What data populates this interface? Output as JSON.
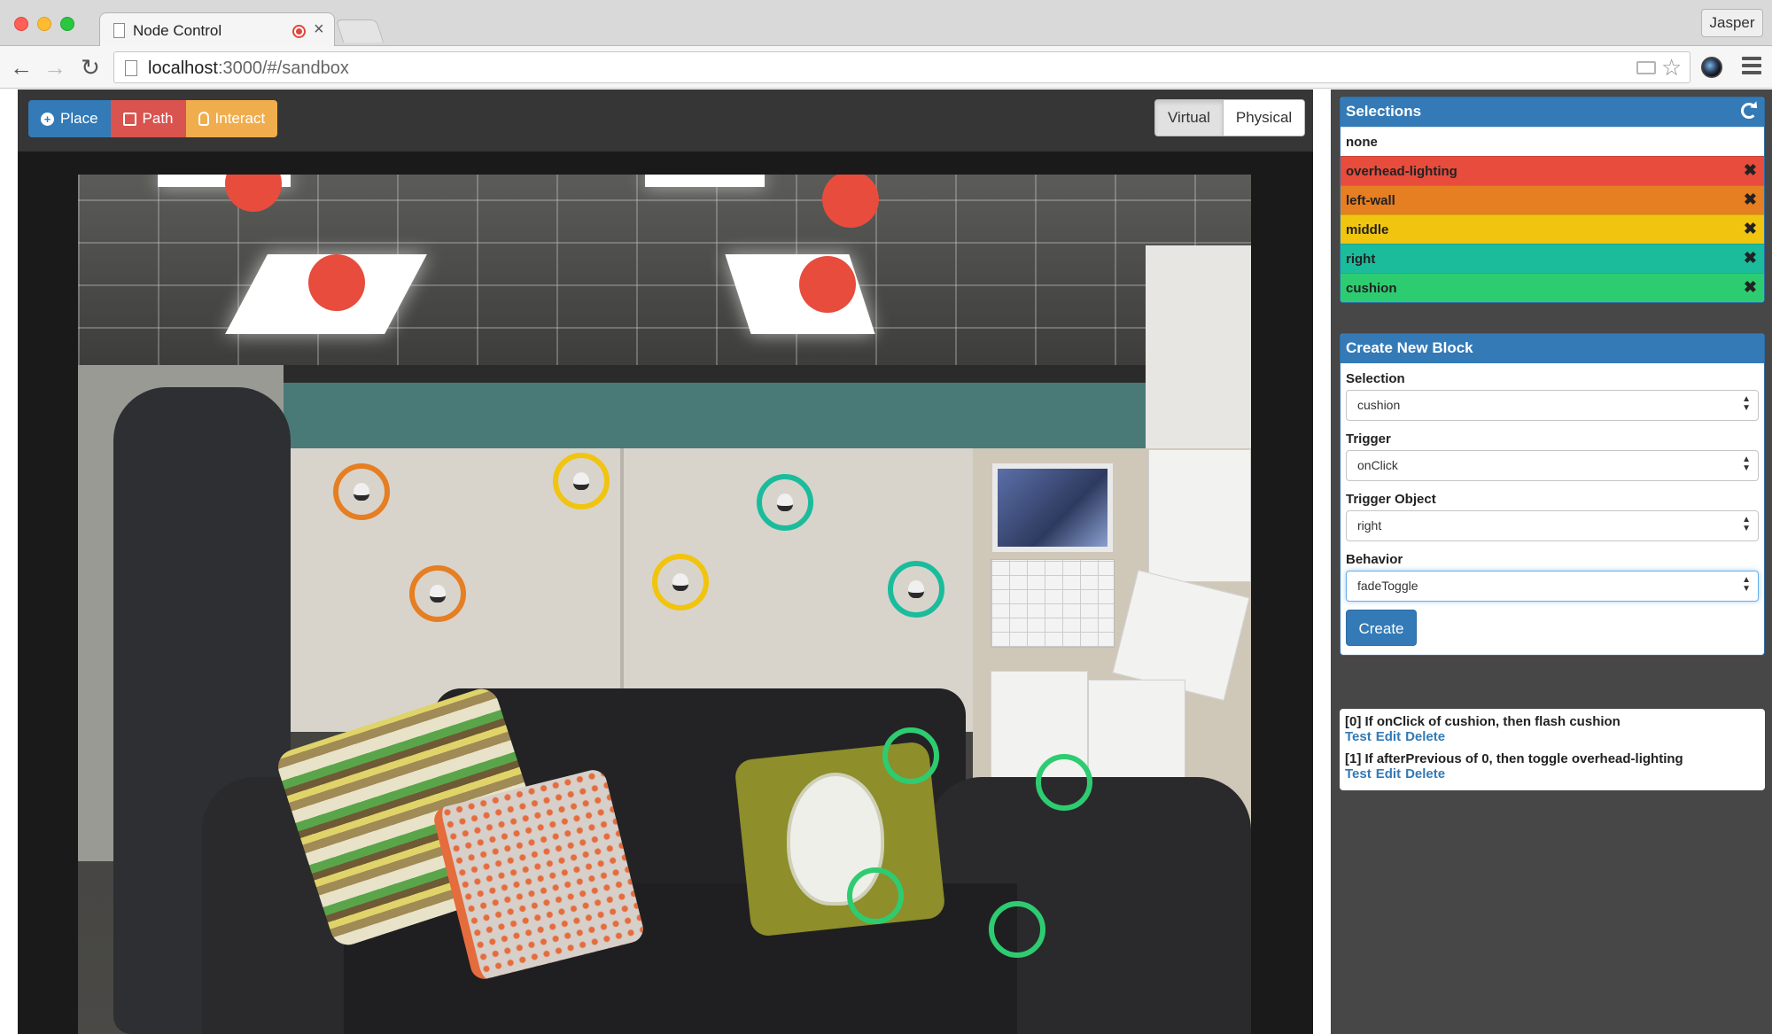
{
  "browser": {
    "tab_title": "Node Control",
    "tab_close": "×",
    "profile_name": "Jasper",
    "url_host": "localhost",
    "url_rest": ":3000/#/sandbox"
  },
  "modes": {
    "place": "Place",
    "path": "Path",
    "interact": "Interact"
  },
  "view_toggle": {
    "virtual": "Virtual",
    "physical": "Physical",
    "active": "Virtual"
  },
  "selections": {
    "title": "Selections",
    "items": [
      {
        "label": "none",
        "color": "#ffffff"
      },
      {
        "label": "overhead-lighting",
        "color": "#e74c3c"
      },
      {
        "label": "left-wall",
        "color": "#e67e22"
      },
      {
        "label": "middle",
        "color": "#f1c40f"
      },
      {
        "label": "right",
        "color": "#1abc9c"
      },
      {
        "label": "cushion",
        "color": "#2ecc71"
      }
    ],
    "remove_glyph": "✖"
  },
  "create_block": {
    "title": "Create New Block",
    "selection_label": "Selection",
    "selection_value": "cushion",
    "trigger_label": "Trigger",
    "trigger_value": "onClick",
    "trigger_object_label": "Trigger Object",
    "trigger_object_value": "right",
    "behavior_label": "Behavior",
    "behavior_value": "fadeToggle",
    "create_label": "Create"
  },
  "blocks": [
    {
      "text": "[0] If onClick of cushion, then flash cushion",
      "test": "Test",
      "edit": "Edit",
      "delete": "Delete"
    },
    {
      "text": "[1] If afterPrevious of 0, then toggle overhead-lighting",
      "test": "Test",
      "edit": "Edit",
      "delete": "Delete"
    }
  ],
  "icons": {
    "place": "plus-circle-icon",
    "path": "edit-icon",
    "interact": "hand-pointer-icon",
    "refresh": "refresh-icon"
  },
  "colors": {
    "primary": "#337ab7",
    "danger": "#d9534f",
    "warning": "#f0ad4e",
    "overhead_lighting": "#e74c3c",
    "left_wall": "#e67e22",
    "middle": "#f1c40f",
    "right": "#1abc9c",
    "cushion": "#2ecc71"
  }
}
